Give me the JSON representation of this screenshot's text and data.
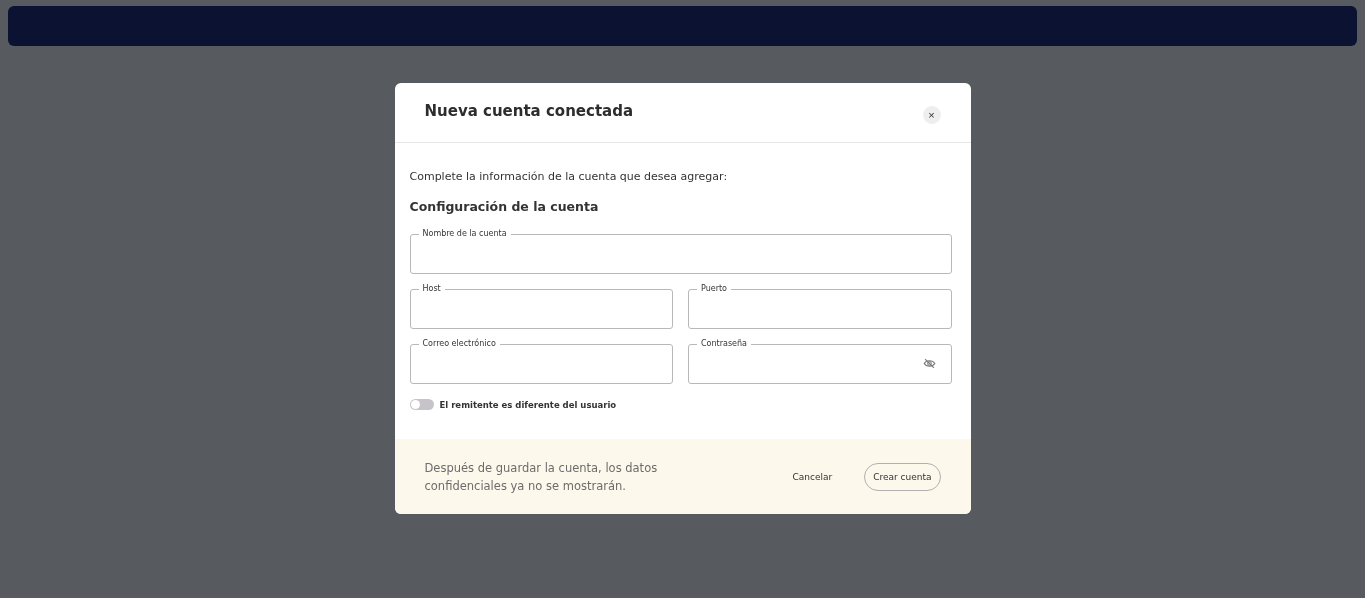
{
  "dialog": {
    "title": "Nueva cuenta conectada",
    "close": "×",
    "intro": "Complete la información de la cuenta que desea agregar:",
    "section": "Configuración de la cuenta",
    "field_rows": [
      [
        {
          "label": "Nombre de la cuenta",
          "kind": "text"
        }
      ],
      [
        {
          "label": "Host",
          "kind": "text"
        },
        {
          "label": "Puerto",
          "kind": "text"
        }
      ],
      [
        {
          "label": "Correo electrónico",
          "kind": "text"
        },
        {
          "label": "Contraseña",
          "kind": "password"
        }
      ]
    ],
    "toggle": {
      "label": "El remitente es diferente del usuario",
      "on": false
    },
    "footer_note": "Después de guardar la cuenta, los datos confidenciales ya no se mostrarán.",
    "buttons": [
      {
        "label": "Cancelar",
        "kind": "plain"
      },
      {
        "label": "Crear cuenta",
        "kind": "outlined"
      }
    ]
  }
}
